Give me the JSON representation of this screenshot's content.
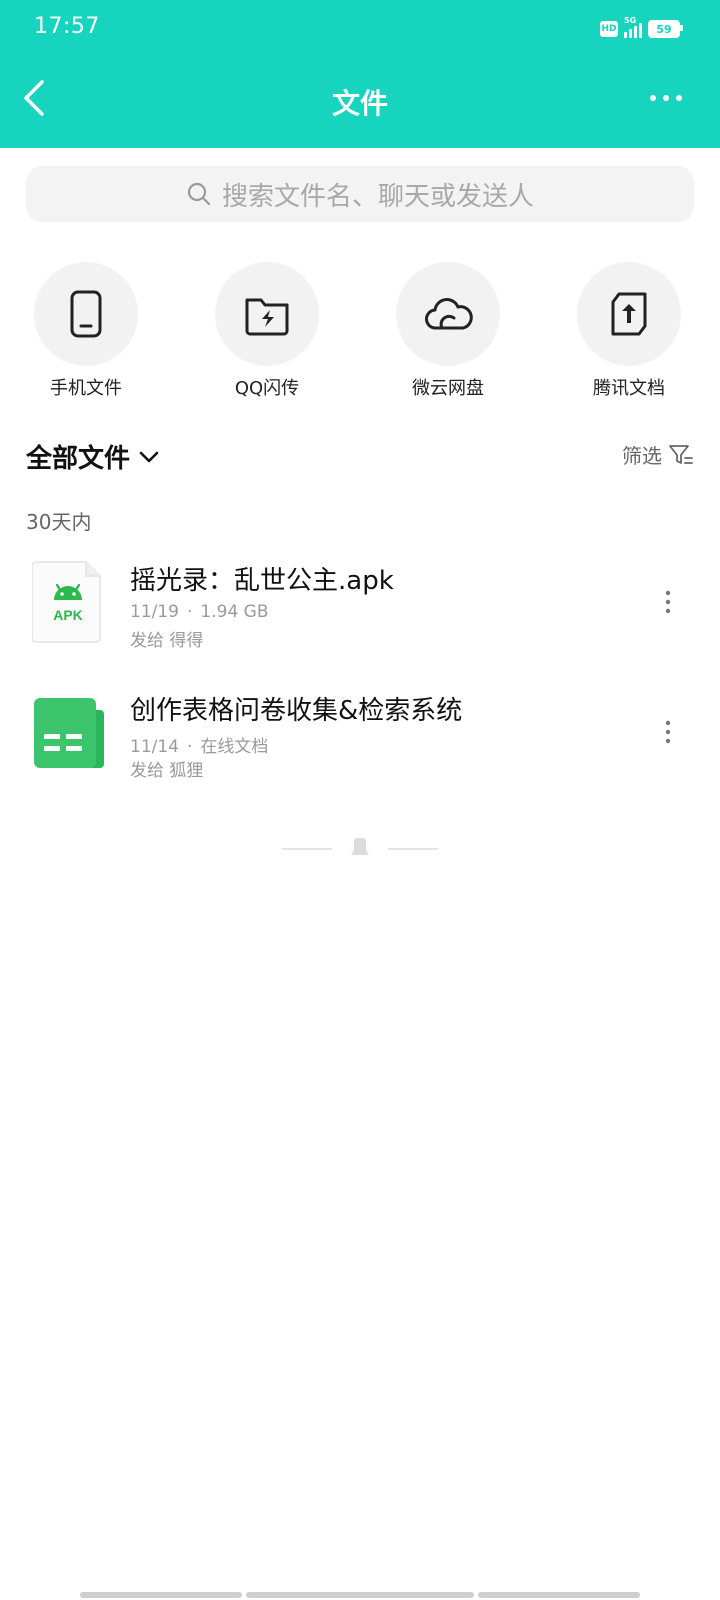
{
  "status": {
    "time": "17:57",
    "network": "5G",
    "battery": "59",
    "hd": "HD"
  },
  "nav": {
    "title": "文件"
  },
  "search": {
    "placeholder": "搜索文件名、聊天或发送人"
  },
  "quick_access": [
    {
      "label": "手机文件",
      "icon": "phone-icon"
    },
    {
      "label": "QQ闪传",
      "icon": "flash-folder-icon"
    },
    {
      "label": "微云网盘",
      "icon": "cloud-icon"
    },
    {
      "label": "腾讯文档",
      "icon": "tencent-docs-icon"
    }
  ],
  "section": {
    "title": "全部文件",
    "filter_label": "筛选"
  },
  "period_label": "30天内",
  "files": [
    {
      "name": "摇光录：乱世公主.apk",
      "date": "11/19",
      "detail": "1.94 GB",
      "sent_to": "发给 得得",
      "icon": "apk-file-icon",
      "icon_text": "APK"
    },
    {
      "name": "创作表格问卷收集&检索系统",
      "date": "11/14",
      "detail": "在线文档",
      "sent_to": "发给 狐狸",
      "icon": "spreadsheet-file-icon"
    }
  ],
  "colors": {
    "header": "#16d4bd",
    "android_green": "#2db84d",
    "sheet_green": "#3cc46a"
  }
}
